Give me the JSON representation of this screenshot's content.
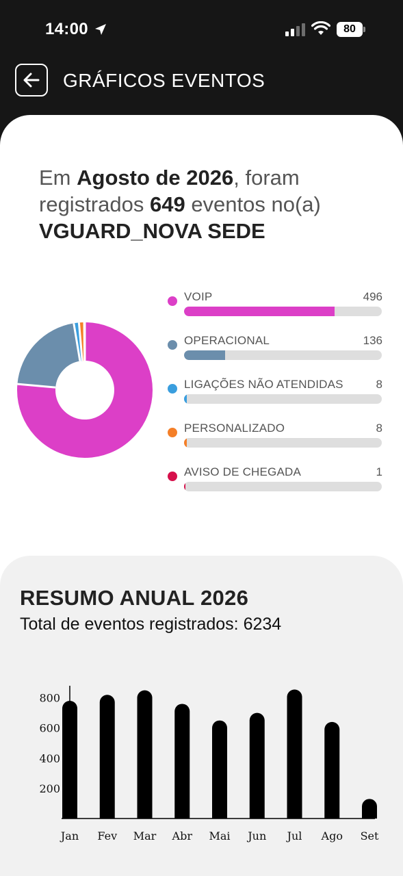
{
  "status_bar": {
    "time": "14:00",
    "battery": "80"
  },
  "header": {
    "title": "GRÁFICOS EVENTOS"
  },
  "summary": {
    "prefix": "Em ",
    "month": "Agosto de 2026",
    "middle": ", foram registrados ",
    "count": "649",
    "suffix": " eventos no(a)",
    "site": "VGUARD_NOVA SEDE"
  },
  "legend": [
    {
      "label": "VOIP",
      "value": 496,
      "color": "#dc3fc7"
    },
    {
      "label": "OPERACIONAL",
      "value": 136,
      "color": "#6b8eac"
    },
    {
      "label": "LIGAÇÕES NÃO ATENDIDAS",
      "value": 8,
      "color": "#3a9ede"
    },
    {
      "label": "PERSONALIZADO",
      "value": 8,
      "color": "#f47f28"
    },
    {
      "label": "AVISO DE CHEGADA",
      "value": 1,
      "color": "#d6104b"
    }
  ],
  "annual": {
    "title": "RESUMO ANUAL 2026",
    "total_label": "Total de eventos registrados: 6234"
  },
  "chart_data": {
    "type": "bar",
    "categories": [
      "Jan",
      "Fev",
      "Mar",
      "Abr",
      "Mai",
      "Jun",
      "Jul",
      "Ago",
      "Set"
    ],
    "values": [
      780,
      820,
      850,
      760,
      650,
      700,
      855,
      640,
      130
    ],
    "yticks": [
      200,
      400,
      600,
      800
    ],
    "ylim": [
      0,
      880
    ],
    "bar_color": "#000000"
  }
}
